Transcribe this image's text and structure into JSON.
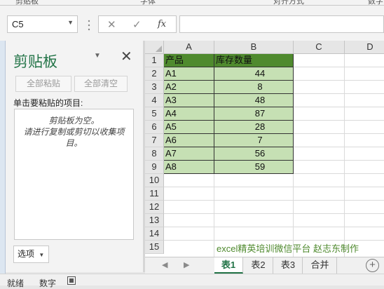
{
  "ribbon": {
    "groups": [
      "剪贴板",
      "字体",
      "对齐方式",
      "数字"
    ]
  },
  "formula_bar": {
    "name_box": "C5",
    "cancel_icon": "✕",
    "enter_icon": "✓",
    "fx_label": "fx",
    "formula": ""
  },
  "clipboard_pane": {
    "title": "剪贴板",
    "paste_all": "全部粘贴",
    "clear_all": "全部清空",
    "instruction": "单击要粘贴的项目:",
    "empty_line1": "剪贴板为空。",
    "empty_line2": "请进行复制或剪切以收集项目。",
    "options": "选项"
  },
  "grid": {
    "columns": [
      "A",
      "B",
      "C",
      "D"
    ],
    "rows": [
      "1",
      "2",
      "3",
      "4",
      "5",
      "6",
      "7",
      "8",
      "9",
      "10",
      "11",
      "12",
      "13",
      "14",
      "15"
    ],
    "header": [
      "产品",
      "库存数量"
    ],
    "data": [
      [
        "A1",
        "44"
      ],
      [
        "A2",
        "8"
      ],
      [
        "A3",
        "48"
      ],
      [
        "A4",
        "87"
      ],
      [
        "A5",
        "28"
      ],
      [
        "A6",
        "7"
      ],
      [
        "A7",
        "56"
      ],
      [
        "A8",
        "59"
      ]
    ],
    "credit": "excel精英培训微信平台 赵志东制作"
  },
  "sheets": {
    "tabs": [
      "表1",
      "表2",
      "表3",
      "合并"
    ],
    "active": 0
  },
  "status": {
    "ready": "就绪",
    "mode": "数字"
  },
  "colors": {
    "accent": "#217346",
    "header_fill": "#4f8a2e",
    "data_fill": "#c6e0b4"
  }
}
